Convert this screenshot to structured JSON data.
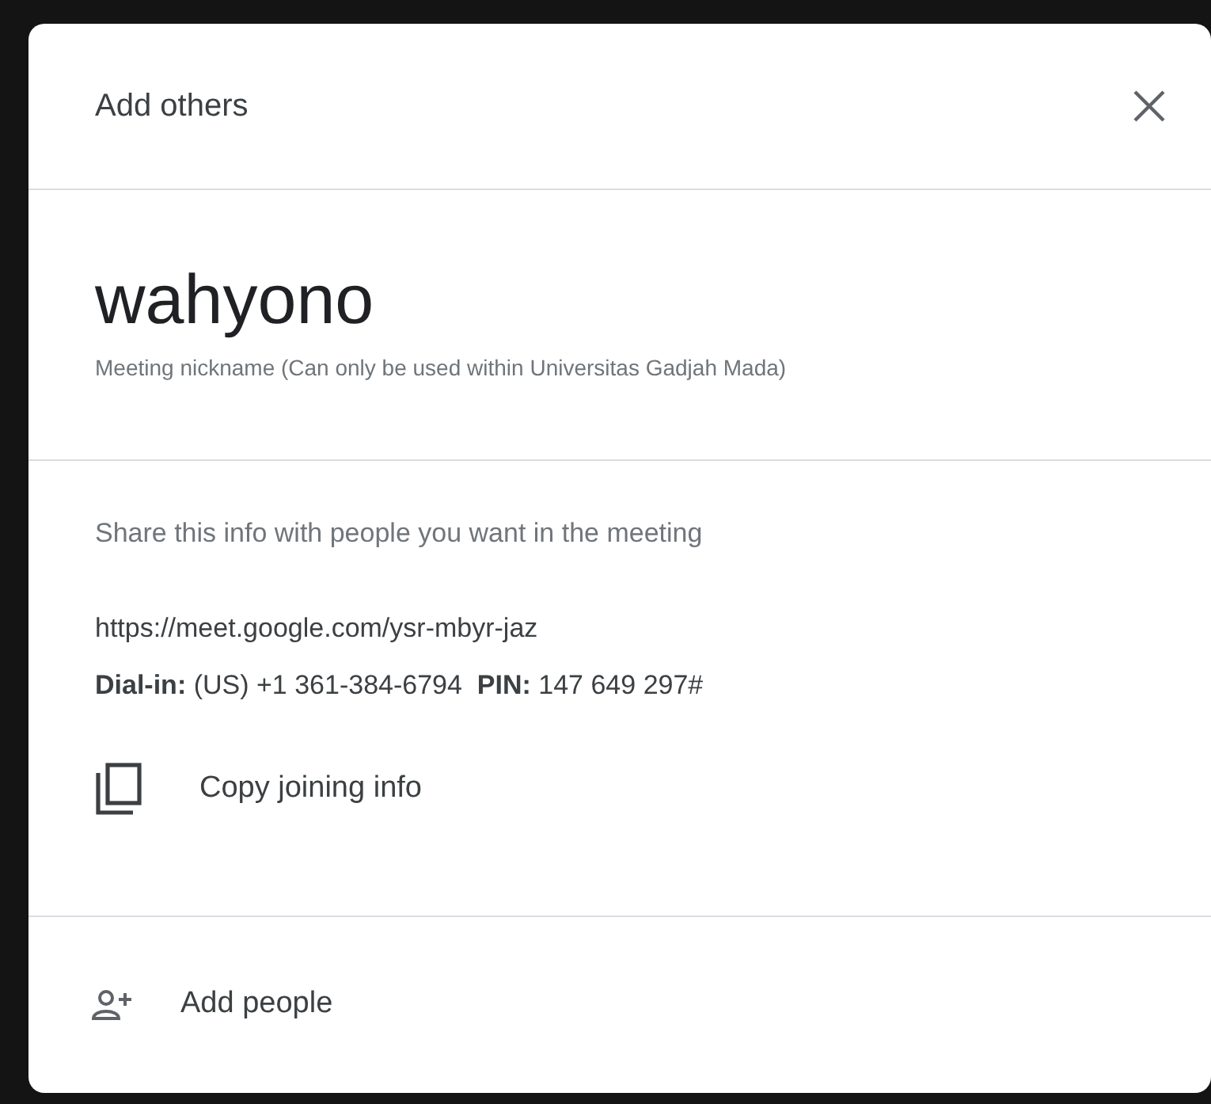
{
  "dialog": {
    "title": "Add others"
  },
  "meeting": {
    "nickname": "wahyono",
    "note": "Meeting nickname (Can only be used within Universitas Gadjah Mada)"
  },
  "share": {
    "hint": "Share this info with people you want in the meeting",
    "link": "https://meet.google.com/ysr-mbyr-jaz",
    "dial_in": "**Dial-in:** (US) +1 361-384-6794  **PIN:** 147 649 297#",
    "copy_label": "Copy joining info"
  },
  "add_people": {
    "label": "Add people"
  }
}
